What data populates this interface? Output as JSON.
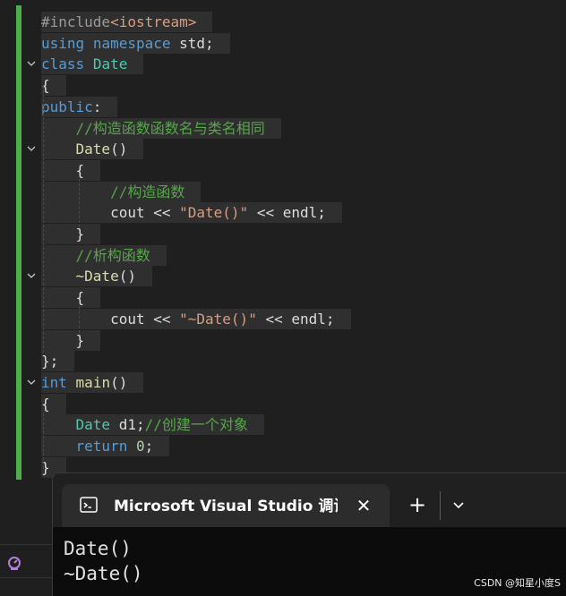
{
  "editor": {
    "lines": [
      {
        "fold": "",
        "segments": [
          {
            "cls": "pp",
            "text": "#include"
          },
          {
            "cls": "str",
            "text": "<iostream>"
          }
        ]
      },
      {
        "fold": "",
        "segments": [
          {
            "cls": "kw",
            "text": "using"
          },
          {
            "cls": "pl",
            "text": " "
          },
          {
            "cls": "kw",
            "text": "namespace"
          },
          {
            "cls": "pl",
            "text": " std;"
          }
        ]
      },
      {
        "fold": "v",
        "segments": [
          {
            "cls": "kw",
            "text": "class"
          },
          {
            "cls": "pl",
            "text": " "
          },
          {
            "cls": "ty",
            "text": "Date"
          }
        ]
      },
      {
        "fold": "",
        "segments": [
          {
            "cls": "pl",
            "text": "{"
          }
        ]
      },
      {
        "fold": "",
        "segments": [
          {
            "cls": "kw",
            "text": "public"
          },
          {
            "cls": "pl",
            "text": ":"
          }
        ]
      },
      {
        "fold": "",
        "segments": [
          {
            "cls": "pl",
            "text": "    "
          },
          {
            "cls": "cm",
            "text": "//构造函数函数名与类名相同"
          }
        ]
      },
      {
        "fold": "v",
        "segments": [
          {
            "cls": "pl",
            "text": "    "
          },
          {
            "cls": "fn",
            "text": "Date"
          },
          {
            "cls": "pl",
            "text": "()"
          }
        ]
      },
      {
        "fold": "",
        "segments": [
          {
            "cls": "pl",
            "text": "    {"
          }
        ]
      },
      {
        "fold": "",
        "segments": [
          {
            "cls": "pl",
            "text": "        "
          },
          {
            "cls": "cm",
            "text": "//构造函数"
          }
        ]
      },
      {
        "fold": "",
        "segments": [
          {
            "cls": "pl",
            "text": "        cout << "
          },
          {
            "cls": "str",
            "text": "\"Date()\""
          },
          {
            "cls": "pl",
            "text": " << endl;"
          }
        ]
      },
      {
        "fold": "",
        "segments": [
          {
            "cls": "pl",
            "text": "    }"
          }
        ]
      },
      {
        "fold": "",
        "segments": [
          {
            "cls": "pl",
            "text": "    "
          },
          {
            "cls": "cm",
            "text": "//析构函数"
          }
        ]
      },
      {
        "fold": "v",
        "segments": [
          {
            "cls": "pl",
            "text": "    "
          },
          {
            "cls": "fn",
            "text": "~Date"
          },
          {
            "cls": "pl",
            "text": "()"
          }
        ]
      },
      {
        "fold": "",
        "segments": [
          {
            "cls": "pl",
            "text": "    {"
          }
        ]
      },
      {
        "fold": "",
        "segments": [
          {
            "cls": "pl",
            "text": "        cout << "
          },
          {
            "cls": "str",
            "text": "\"~Date()\""
          },
          {
            "cls": "pl",
            "text": " << endl;"
          }
        ]
      },
      {
        "fold": "",
        "segments": [
          {
            "cls": "pl",
            "text": "    }"
          }
        ]
      },
      {
        "fold": "",
        "segments": [
          {
            "cls": "pl",
            "text": "};"
          }
        ]
      },
      {
        "fold": "v",
        "segments": [
          {
            "cls": "kw",
            "text": "int"
          },
          {
            "cls": "pl",
            "text": " "
          },
          {
            "cls": "fn",
            "text": "main"
          },
          {
            "cls": "pl",
            "text": "()"
          }
        ]
      },
      {
        "fold": "",
        "segments": [
          {
            "cls": "pl",
            "text": "{"
          }
        ]
      },
      {
        "fold": "",
        "segments": [
          {
            "cls": "pl",
            "text": "    "
          },
          {
            "cls": "ty",
            "text": "Date"
          },
          {
            "cls": "pl",
            "text": " d1;"
          },
          {
            "cls": "cm",
            "text": "//创建一个对象"
          }
        ]
      },
      {
        "fold": "",
        "segments": [
          {
            "cls": "pl",
            "text": "    "
          },
          {
            "cls": "kw",
            "text": "return"
          },
          {
            "cls": "pl",
            "text": " "
          },
          {
            "cls": "num",
            "text": "0"
          },
          {
            "cls": "pl",
            "text": ";"
          }
        ]
      },
      {
        "fold": "",
        "segments": [
          {
            "cls": "pl",
            "text": "}"
          }
        ]
      }
    ]
  },
  "terminal": {
    "tab_title": "Microsoft Visual Studio 调试控制台",
    "tab_icon": "console-icon",
    "close_icon": "close-icon",
    "new_tab_icon": "plus-icon",
    "dropdown_icon": "chevron-down-icon",
    "output": [
      "Date()",
      "~Date()"
    ]
  },
  "sidebar": {
    "icon": "performance-profiler-icon"
  },
  "watermark": "CSDN @知星小度S",
  "colors": {
    "change_bar": "#4fae4a",
    "keyword": "#569cd6",
    "type": "#4ec9b0",
    "function": "#dcdcaa",
    "string": "#d69d85",
    "comment": "#57a64a"
  }
}
